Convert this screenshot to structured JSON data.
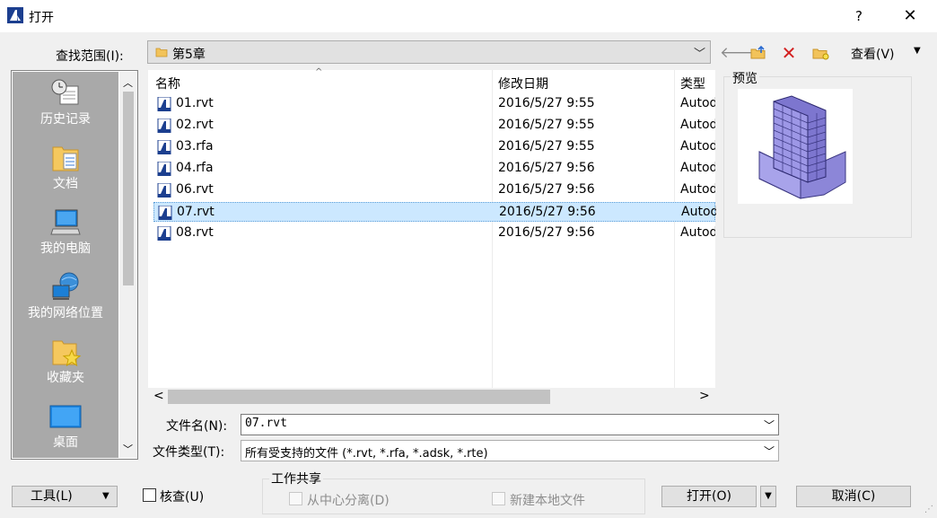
{
  "window": {
    "title": "打开",
    "help": "?",
    "close": "✕"
  },
  "toolbar": {
    "lookin_label": "查找范围(I):",
    "lookin_value": "第5章",
    "views_label": "查看(V)",
    "combo_arrow": "﹀",
    "dropdown_arrow": "▼",
    "back_icon": "🡐"
  },
  "places": [
    {
      "label": "历史记录",
      "icon": "history-icon"
    },
    {
      "label": "文档",
      "icon": "documents-icon"
    },
    {
      "label": "我的电脑",
      "icon": "computer-icon"
    },
    {
      "label": "我的网络位置",
      "icon": "network-icon"
    },
    {
      "label": "收藏夹",
      "icon": "favorites-icon"
    },
    {
      "label": "桌面",
      "icon": "desktop-icon"
    }
  ],
  "filelist": {
    "headers": {
      "name": "名称",
      "date": "修改日期",
      "type": "类型"
    },
    "sort_indicator": "^",
    "rows": [
      {
        "name": "01.rvt",
        "date": "2016/5/27 9:55",
        "type": "Autodesk"
      },
      {
        "name": "02.rvt",
        "date": "2016/5/27 9:55",
        "type": "Autodesk"
      },
      {
        "name": "03.rfa",
        "date": "2016/5/27 9:55",
        "type": "Autodesk"
      },
      {
        "name": "04.rfa",
        "date": "2016/5/27 9:56",
        "type": "Autodesk"
      },
      {
        "name": "06.rvt",
        "date": "2016/5/27 9:56",
        "type": "Autodesk"
      },
      {
        "name": "07.rvt",
        "date": "2016/5/27 9:56",
        "type": "Autodesk",
        "selected": true
      },
      {
        "name": "08.rvt",
        "date": "2016/5/27 9:56",
        "type": "Autodesk"
      }
    ]
  },
  "preview": {
    "label": "预览"
  },
  "filename": {
    "label": "文件名(N):",
    "value": "07.rvt"
  },
  "filetype": {
    "label": "文件类型(T):",
    "value": "所有受支持的文件 (*.rvt, *.rfa, *.adsk, *.rte)"
  },
  "bottom": {
    "tools_label": "工具(L)",
    "audit_label": "核查(U)",
    "worksharing_label": "工作共享",
    "detach_label": "从中心分离(D)",
    "newlocal_label": "新建本地文件",
    "open_label": "打开(O)",
    "cancel_label": "取消(C)"
  },
  "colors": {
    "selection": "#cce8ff",
    "sidebar": "#a9a9a9",
    "accent": "#1e63b4"
  }
}
